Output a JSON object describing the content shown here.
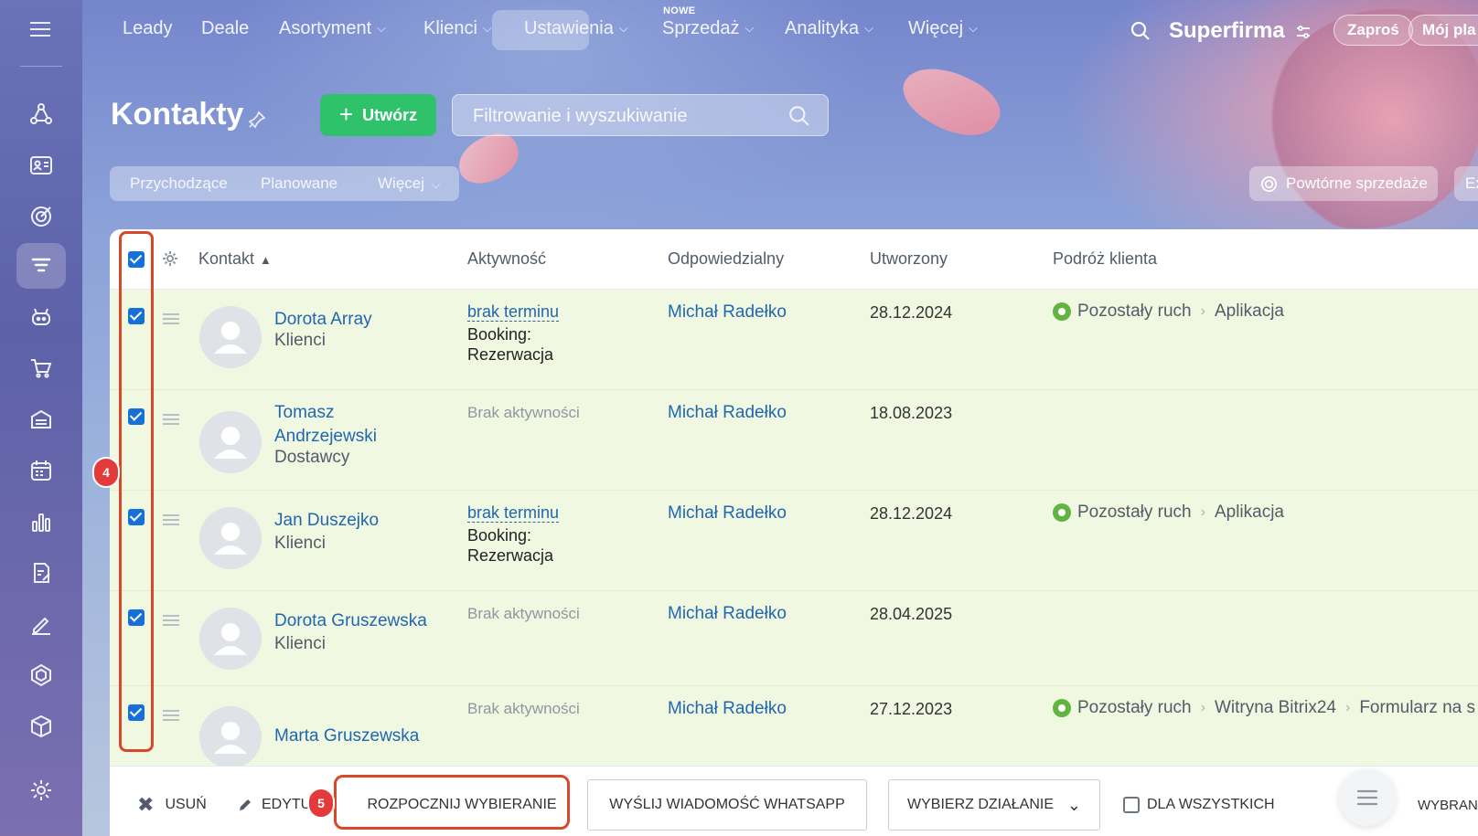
{
  "topnav": {
    "items": [
      {
        "label": "Leady",
        "chevron": false
      },
      {
        "label": "Deale",
        "chevron": false
      },
      {
        "label": "Asortyment",
        "chevron": true
      },
      {
        "label": "Klienci",
        "chevron": true
      },
      {
        "label": "Ustawienia",
        "chevron": true
      },
      {
        "label": "Sprzedaż",
        "chevron": true
      },
      {
        "label": "Analityka",
        "chevron": true
      },
      {
        "label": "Więcej",
        "chevron": true
      }
    ],
    "active": "Klienci",
    "new_badge": "NOWE",
    "brand": "Superfirma",
    "invite_label": "Zaproś",
    "plan_label": "Mój pla"
  },
  "page": {
    "title": "Kontakty",
    "create_label": "Utwórz",
    "search_placeholder": "Filtrowanie i wyszukiwanie"
  },
  "filters": {
    "tabs": [
      "Przychodzące",
      "Planowane",
      "Więcej"
    ],
    "repeat_sales": "Powtórne sprzedaże",
    "extra": "Ex"
  },
  "grid": {
    "columns": [
      "Kontakt",
      "Aktywność",
      "Odpowiedzialny",
      "Utworzony",
      "Podróż klienta"
    ],
    "rows": [
      {
        "name": "Dorota Array",
        "type": "Klienci",
        "activity_link": "brak terminu",
        "activity_text": "Booking: Rezerwacja",
        "responsible": "Michał Radełko",
        "created": "28.12.2024",
        "journey": [
          "Pozostały ruch",
          "Aplikacja"
        ]
      },
      {
        "name": "Tomasz Andrzejewski",
        "type": "Dostawcy",
        "activity_none": "Brak aktywności",
        "responsible": "Michał Radełko",
        "created": "18.08.2023",
        "journey": []
      },
      {
        "name": "Jan Duszejko",
        "type": "Klienci",
        "activity_link": "brak terminu",
        "activity_text": "Booking: Rezerwacja",
        "responsible": "Michał Radełko",
        "created": "28.12.2024",
        "journey": [
          "Pozostały ruch",
          "Aplikacja"
        ]
      },
      {
        "name": "Dorota Gruszewska",
        "type": "Klienci",
        "activity_none": "Brak aktywności",
        "responsible": "Michał Radełko",
        "created": "28.04.2025",
        "journey": []
      },
      {
        "name": "Marta Gruszewska",
        "type": "",
        "activity_none": "Brak aktywności",
        "responsible": "Michał Radełko",
        "created": "27.12.2023",
        "journey": [
          "Pozostały ruch",
          "Witryna Bitrix24",
          "Formularz na s"
        ]
      }
    ]
  },
  "annotations": {
    "badge_checkboxes": "4",
    "badge_start": "5"
  },
  "footer": {
    "delete": "USUŃ",
    "edit": "EDYTU",
    "start_dialing": "ROZPOCZNIJ WYBIERANIE",
    "whatsapp": "WYŚLIJ WIADOMOŚĆ WHATSAPP",
    "choose_action": "WYBIERZ DZIAŁANIE",
    "for_all": "DLA WSZYSTKICH",
    "selected": "WYBRANO"
  },
  "colors": {
    "accent_green": "#2fc26b",
    "link_blue": "#2067b0",
    "checkbox_blue": "#1570d8",
    "highlight_red": "#d9472b",
    "row_bg": "#f1f8e1"
  }
}
